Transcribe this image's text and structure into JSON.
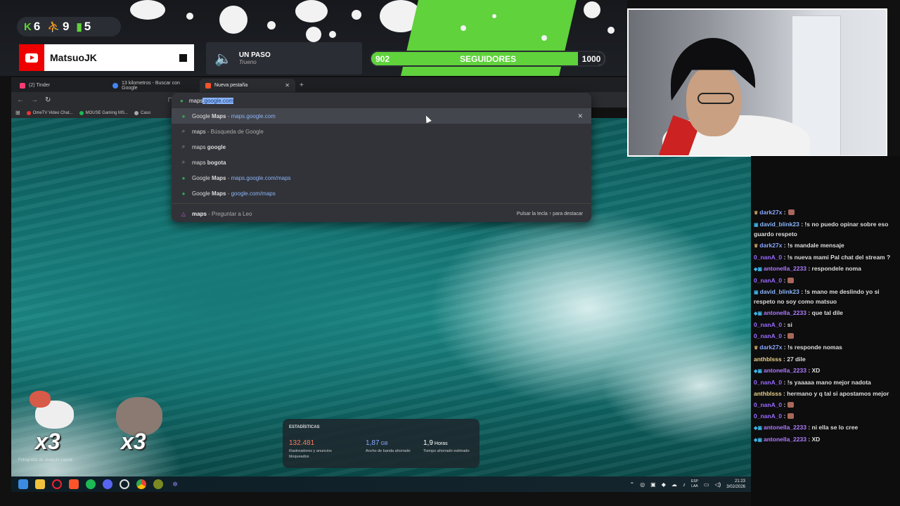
{
  "overlay": {
    "stats": [
      {
        "icon": "k-icon",
        "value": "6"
      },
      {
        "icon": "person-icon",
        "value": "9"
      },
      {
        "icon": "bars-icon",
        "value": "5"
      }
    ],
    "channel_name": "MatsuoJK",
    "song": {
      "title": "UN PASO",
      "artist": "Trueno"
    },
    "followers": {
      "current": "902",
      "label": "SEGUIDORES",
      "goal": "1000",
      "progress_fraction": 0.902
    },
    "accent_color": "#5fd23c"
  },
  "browser": {
    "tabs": [
      {
        "title": "(2) Tinder",
        "favicon_color": "#fe3c72",
        "active": false
      },
      {
        "title": "13 kilometros - Buscar con Google",
        "favicon_color": "#4285f4",
        "active": false
      },
      {
        "title": "Nueva pestaña",
        "favicon_color": "#fb542b",
        "active": true
      }
    ],
    "omnibox": {
      "typed": "maps",
      "autocomplete": ".google.com",
      "suggestions": [
        {
          "icon": "maps-pin-icon",
          "prefix": "Google ",
          "bold": "Maps",
          "sep": " - ",
          "url": "maps.google.com",
          "selected": true
        },
        {
          "icon": "search-icon",
          "prefix": "maps",
          "bold": "",
          "sep": " - ",
          "rest": "Búsqueda de Google"
        },
        {
          "icon": "search-icon",
          "prefix": "maps ",
          "bold": "google"
        },
        {
          "icon": "search-icon",
          "prefix": "maps ",
          "bold": "bogota"
        },
        {
          "icon": "maps-pin-icon",
          "prefix": "Google ",
          "bold": "Maps",
          "sep": " - ",
          "url": "maps.google.com/maps"
        },
        {
          "icon": "maps-pin-icon",
          "prefix": "Google ",
          "bold": "Maps",
          "sep": " - ",
          "url": "google.com/maps"
        }
      ],
      "leo": {
        "prefix": "maps",
        "rest": " - Preguntar a Leo",
        "hint": "Pulsar la tecla ↑ para destacar"
      }
    },
    "bookmarks": [
      "OmeTV Video Chat...",
      "MOUSE Gaming MS...",
      "Caso"
    ],
    "stats_widget": {
      "title": "ESTADÍSTICAS",
      "items": [
        {
          "value": "132.481",
          "unit": "",
          "desc": "Rastreadores y anuncios bloqueados",
          "color": "#ff7a5a"
        },
        {
          "value": "1,87",
          "unit": "GB",
          "desc": "Ancho de banda ahorrado",
          "color": "#8aa6ff"
        },
        {
          "value": "1,9",
          "unit": "Horas",
          "desc": "Tiempo ahorrado estimado",
          "color": "#ffffff"
        }
      ]
    },
    "photo_credit": "Fotografía de Joaquín Leone"
  },
  "emotes": [
    {
      "label": "x3"
    },
    {
      "label": "x3"
    }
  ],
  "taskbar": {
    "lang": [
      "ESP",
      "LAA"
    ],
    "time": "21:23",
    "date": "3/02/2026"
  },
  "chat": [
    {
      "user": "dark27x",
      "color": "#8aa6ff",
      "badge": "crown",
      "msg": ":",
      "emote": true
    },
    {
      "user": "david_blink23",
      "color": "#8ab4f8",
      "badge": "box",
      "msg": ": !s no puedo opinar sobre eso guardo respeto"
    },
    {
      "user": "dark27x",
      "color": "#8aa6ff",
      "badge": "crown",
      "msg": ": !s mandale mensaje"
    },
    {
      "user": "0_nanA_0",
      "color": "#9b6bff",
      "badge": "",
      "msg": ": !s nueva mami Pal chat del stream ?"
    },
    {
      "user": "antonella_2233",
      "color": "#b07cff",
      "badge": "multi",
      "msg": ": respondele noma"
    },
    {
      "user": "0_nanA_0",
      "color": "#9b6bff",
      "badge": "",
      "msg": ":",
      "emote": true
    },
    {
      "user": "david_blink23",
      "color": "#8ab4f8",
      "badge": "box",
      "msg": ": !s mano me deslindo yo si respeto no soy como matsuo"
    },
    {
      "user": "antonella_2233",
      "color": "#b07cff",
      "badge": "multi",
      "msg": ": que tal dile"
    },
    {
      "user": "0_nanA_0",
      "color": "#9b6bff",
      "badge": "",
      "msg": ": si"
    },
    {
      "user": "0_nanA_0",
      "color": "#9b6bff",
      "badge": "",
      "msg": ":",
      "emote": true
    },
    {
      "user": "dark27x",
      "color": "#8aa6ff",
      "badge": "crown",
      "msg": ": !s responde nomas"
    },
    {
      "user": "anthblsss",
      "color": "#e8d08a",
      "badge": "",
      "msg": ": 27 dile"
    },
    {
      "user": "antonella_2233",
      "color": "#b07cff",
      "badge": "multi",
      "msg": ": XD"
    },
    {
      "user": "0_nanA_0",
      "color": "#9b6bff",
      "badge": "",
      "msg": ": !s yaaaaa mano mejor nadota"
    },
    {
      "user": "anthblsss",
      "color": "#e8d08a",
      "badge": "",
      "msg": ": hermano y q tal si apostamos mejor"
    },
    {
      "user": "0_nanA_0",
      "color": "#9b6bff",
      "badge": "",
      "msg": ":",
      "emote": true
    },
    {
      "user": "0_nanA_0",
      "color": "#9b6bff",
      "badge": "",
      "msg": ":",
      "emote": true
    },
    {
      "user": "antonella_2233",
      "color": "#b07cff",
      "badge": "multi",
      "msg": ": ni ella se lo cree"
    },
    {
      "user": "antonella_2233",
      "color": "#b07cff",
      "badge": "multi",
      "msg": ": XD"
    }
  ]
}
